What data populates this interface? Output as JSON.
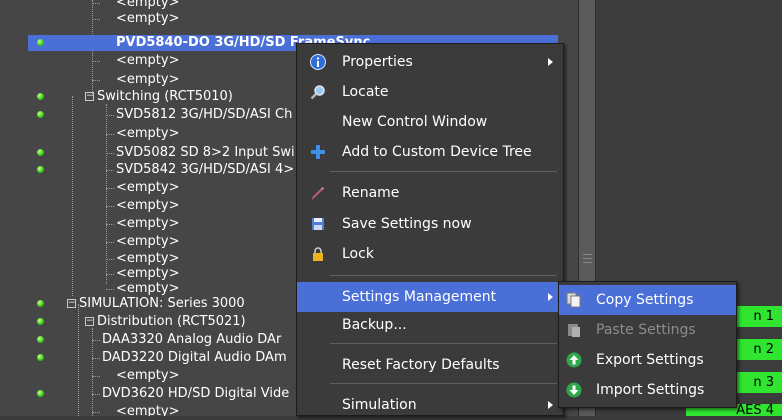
{
  "tree": {
    "rows": [
      {
        "label": "<empty>",
        "led": false,
        "expander": ""
      },
      {
        "label": "<empty>",
        "led": false,
        "expander": ""
      },
      {
        "label": "PVD5840-DO 3G/HD/SD FrameSync",
        "led": true,
        "expander": "",
        "selected": true
      },
      {
        "label": "<empty>",
        "led": false,
        "expander": ""
      },
      {
        "label": "<empty>",
        "led": false,
        "expander": ""
      },
      {
        "label": "Switching (RCT5010)",
        "led": true,
        "expander": "−"
      },
      {
        "label": "SVD5812 3G/HD/SD/ASI Ch",
        "led": true,
        "expander": ""
      },
      {
        "label": "<empty>",
        "led": false,
        "expander": ""
      },
      {
        "label": "SVD5082 SD 8>2 Input Swi",
        "led": true,
        "expander": ""
      },
      {
        "label": "SVD5842 3G/HD/SD/ASI 4>",
        "led": true,
        "expander": ""
      },
      {
        "label": "<empty>",
        "led": false,
        "expander": ""
      },
      {
        "label": "<empty>",
        "led": false,
        "expander": ""
      },
      {
        "label": "<empty>",
        "led": false,
        "expander": ""
      },
      {
        "label": "<empty>",
        "led": false,
        "expander": ""
      },
      {
        "label": "<empty>",
        "led": false,
        "expander": ""
      },
      {
        "label": "<empty>",
        "led": false,
        "expander": ""
      },
      {
        "label": "<empty>",
        "led": false,
        "expander": ""
      },
      {
        "label": "SIMULATION: Series 3000",
        "led": true,
        "expander": "−"
      },
      {
        "label": "Distribution (RCT5021)",
        "led": true,
        "expander": "−"
      },
      {
        "label": "DAA3320 Analog Audio DAr",
        "led": true,
        "expander": ""
      },
      {
        "label": "DAD3220 Digital Audio DAm",
        "led": true,
        "expander": ""
      },
      {
        "label": "<empty>",
        "led": false,
        "expander": ""
      },
      {
        "label": "DVD3620 HD/SD Digital Vide",
        "led": true,
        "expander": ""
      },
      {
        "label": "<empty>",
        "led": false,
        "expander": ""
      }
    ]
  },
  "status_cells": [
    "n 1",
    "n 2",
    "n 3",
    "AES 4"
  ],
  "context_menu": {
    "items": [
      {
        "label": "Properties",
        "icon": "info-icon",
        "submenu": true
      },
      {
        "label": "Locate",
        "icon": "magnifier-icon",
        "submenu": false
      },
      {
        "label": "New Control Window",
        "icon": "",
        "submenu": false
      },
      {
        "label": "Add to Custom Device Tree",
        "icon": "plus-icon",
        "submenu": false
      },
      {
        "label": "Rename",
        "icon": "pencil-icon",
        "submenu": false
      },
      {
        "label": "Save Settings now",
        "icon": "floppy-icon",
        "submenu": false
      },
      {
        "label": "Lock",
        "icon": "padlock-icon",
        "submenu": false
      },
      {
        "label": "Settings Management",
        "icon": "",
        "submenu": true,
        "hover": true
      },
      {
        "label": "Backup...",
        "icon": "",
        "submenu": false
      },
      {
        "label": "Reset Factory Defaults",
        "icon": "",
        "submenu": false
      },
      {
        "label": "Simulation",
        "icon": "",
        "submenu": true
      }
    ]
  },
  "sub_menu": {
    "items": [
      {
        "label": "Copy Settings",
        "icon": "copy-icon",
        "hover": true
      },
      {
        "label": "Paste Settings",
        "icon": "paste-icon",
        "disabled": true
      },
      {
        "label": "Export Settings",
        "icon": "export-arrow-icon"
      },
      {
        "label": "Import Settings",
        "icon": "import-arrow-icon"
      }
    ]
  },
  "colors": {
    "selection": "#4a6fd6",
    "led_green": "#3fcf1c",
    "status_green": "#2fe52f",
    "panel_bg": "#464646"
  }
}
